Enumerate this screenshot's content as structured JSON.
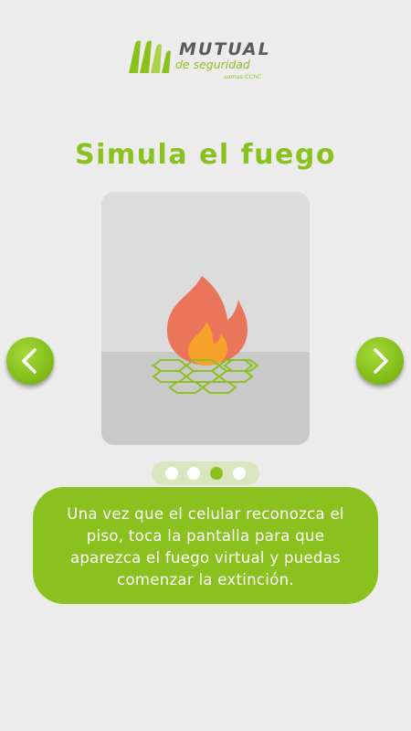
{
  "logo": {
    "word1": "MUTUAL",
    "word2": "de seguridad",
    "word3": "somos CChC"
  },
  "title": "Simula el fuego",
  "carousel": {
    "illustration": "fire-on-floor-grid",
    "prev_icon": "chevron-left-icon",
    "next_icon": "chevron-right-icon",
    "total_pages": 4,
    "current_page": 3
  },
  "description": {
    "lines": [
      "Una vez que el celular reconozca el",
      "piso, toca la pantalla para que",
      "aparezca el fuego virtual y puedas",
      "comenzar la extinción."
    ]
  },
  "colors": {
    "brand_green": "#8ac11e",
    "background": "#ececec",
    "card": "#dcdcdc",
    "fire_outer": "#ec6b4f",
    "fire_inner": "#f7a22b"
  }
}
